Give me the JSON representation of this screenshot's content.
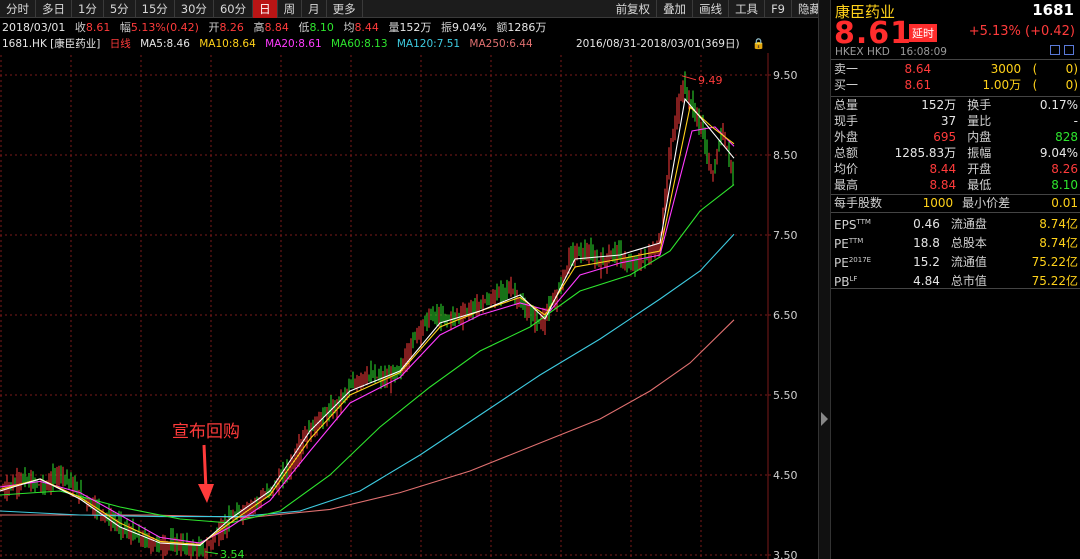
{
  "toolbar": {
    "left_tabs": [
      "分时",
      "多日",
      "1分",
      "5分",
      "15分",
      "30分",
      "60分",
      "日",
      "周",
      "月",
      "更多"
    ],
    "active": "日",
    "right_tabs": [
      "前复权",
      "叠加",
      "画线",
      "工具",
      "F9",
      "隐藏"
    ]
  },
  "info": {
    "date": "2018/03/01",
    "close_label": "收",
    "close": "8.61",
    "change_label": "幅",
    "change": "5.13%(0.42)",
    "open_label": "开",
    "open": "8.26",
    "high_label": "高",
    "high": "8.84",
    "low_label": "低",
    "low": "8.10",
    "avg_label": "均",
    "avg": "8.44",
    "vol_label": "量",
    "vol": "152万",
    "amp_label": "振",
    "amp": "9.04%",
    "amt_label": "额",
    "amt": "1286万"
  },
  "ma_bar": {
    "code": "1681.HK [康臣药业]",
    "period": "日线",
    "ma5": "MA5:8.46",
    "ma10": "MA10:8.64",
    "ma20": "MA20:8.61",
    "ma60": "MA60:8.13",
    "ma120": "MA120:7.51",
    "ma250": "MA250:6.44",
    "range": "2016/08/31-2018/03/01(369日)"
  },
  "chart_data": {
    "type": "line",
    "y_ticks": [
      "9.50",
      "8.50",
      "7.50",
      "6.50",
      "5.50",
      "4.50",
      "3.50"
    ],
    "ylim": [
      3.45,
      9.75
    ],
    "x_days": 369,
    "annotations": {
      "high": "9.49",
      "low": "3.54",
      "event": "宣布回购"
    },
    "colors": {
      "price_up": "#ff3b3b",
      "price_down": "#2ee52e",
      "ma5": "#ffffff",
      "ma10": "#ffd21a",
      "ma20": "#ff3bff",
      "ma60": "#2ee52e",
      "ma120": "#3ecbe0",
      "ma250": "#e07070",
      "grid": "#7a1a1a",
      "axis_text": "#cfcfcf",
      "annotation": "#ff3b3b"
    },
    "price_path": [
      [
        0,
        4.3
      ],
      [
        20,
        4.45
      ],
      [
        45,
        4.35
      ],
      [
        60,
        4.55
      ],
      [
        80,
        4.25
      ],
      [
        100,
        4.05
      ],
      [
        120,
        3.85
      ],
      [
        140,
        3.7
      ],
      [
        160,
        3.62
      ],
      [
        175,
        3.65
      ],
      [
        190,
        3.58
      ],
      [
        205,
        3.55
      ],
      [
        215,
        3.75
      ],
      [
        230,
        3.95
      ],
      [
        250,
        4.1
      ],
      [
        270,
        4.3
      ],
      [
        290,
        4.6
      ],
      [
        305,
        5.0
      ],
      [
        320,
        5.2
      ],
      [
        335,
        5.35
      ],
      [
        350,
        5.6
      ],
      [
        365,
        5.75
      ],
      [
        385,
        5.7
      ],
      [
        400,
        5.8
      ],
      [
        415,
        6.25
      ],
      [
        430,
        6.5
      ],
      [
        445,
        6.45
      ],
      [
        460,
        6.5
      ],
      [
        475,
        6.6
      ],
      [
        490,
        6.7
      ],
      [
        510,
        6.85
      ],
      [
        525,
        6.55
      ],
      [
        540,
        6.4
      ],
      [
        555,
        6.7
      ],
      [
        570,
        7.25
      ],
      [
        585,
        7.3
      ],
      [
        600,
        7.15
      ],
      [
        615,
        7.3
      ],
      [
        630,
        7.1
      ],
      [
        645,
        7.2
      ],
      [
        660,
        7.4
      ],
      [
        670,
        8.6
      ],
      [
        682,
        9.4
      ],
      [
        692,
        9.1
      ],
      [
        702,
        8.8
      ],
      [
        712,
        8.2
      ],
      [
        722,
        8.85
      ],
      [
        734,
        8.1
      ]
    ],
    "ma5": [
      [
        0,
        4.3
      ],
      [
        40,
        4.45
      ],
      [
        80,
        4.2
      ],
      [
        120,
        3.85
      ],
      [
        160,
        3.65
      ],
      [
        200,
        3.62
      ],
      [
        230,
        3.95
      ],
      [
        270,
        4.3
      ],
      [
        310,
        5.05
      ],
      [
        350,
        5.55
      ],
      [
        400,
        5.8
      ],
      [
        440,
        6.4
      ],
      [
        480,
        6.55
      ],
      [
        520,
        6.75
      ],
      [
        545,
        6.45
      ],
      [
        575,
        7.2
      ],
      [
        620,
        7.25
      ],
      [
        660,
        7.4
      ],
      [
        685,
        9.2
      ],
      [
        705,
        8.9
      ],
      [
        734,
        8.46
      ]
    ],
    "ma10": [
      [
        0,
        4.32
      ],
      [
        40,
        4.45
      ],
      [
        80,
        4.22
      ],
      [
        120,
        3.9
      ],
      [
        160,
        3.67
      ],
      [
        200,
        3.63
      ],
      [
        230,
        3.9
      ],
      [
        270,
        4.25
      ],
      [
        310,
        4.95
      ],
      [
        350,
        5.5
      ],
      [
        400,
        5.78
      ],
      [
        440,
        6.35
      ],
      [
        480,
        6.55
      ],
      [
        520,
        6.72
      ],
      [
        545,
        6.5
      ],
      [
        575,
        7.1
      ],
      [
        620,
        7.2
      ],
      [
        660,
        7.3
      ],
      [
        690,
        9.1
      ],
      [
        712,
        8.85
      ],
      [
        734,
        8.64
      ]
    ],
    "ma20": [
      [
        0,
        4.35
      ],
      [
        40,
        4.42
      ],
      [
        80,
        4.28
      ],
      [
        120,
        4.0
      ],
      [
        160,
        3.72
      ],
      [
        200,
        3.65
      ],
      [
        230,
        3.85
      ],
      [
        270,
        4.18
      ],
      [
        310,
        4.8
      ],
      [
        350,
        5.4
      ],
      [
        400,
        5.72
      ],
      [
        440,
        6.25
      ],
      [
        480,
        6.5
      ],
      [
        520,
        6.65
      ],
      [
        550,
        6.55
      ],
      [
        580,
        7.0
      ],
      [
        620,
        7.15
      ],
      [
        660,
        7.25
      ],
      [
        692,
        8.8
      ],
      [
        715,
        8.85
      ],
      [
        734,
        8.61
      ]
    ],
    "ma60": [
      [
        0,
        4.25
      ],
      [
        60,
        4.3
      ],
      [
        120,
        4.1
      ],
      [
        180,
        3.95
      ],
      [
        230,
        3.9
      ],
      [
        280,
        4.05
      ],
      [
        330,
        4.5
      ],
      [
        380,
        5.1
      ],
      [
        430,
        5.6
      ],
      [
        480,
        6.05
      ],
      [
        530,
        6.35
      ],
      [
        580,
        6.8
      ],
      [
        630,
        7.0
      ],
      [
        670,
        7.3
      ],
      [
        700,
        7.8
      ],
      [
        734,
        8.13
      ]
    ],
    "ma120": [
      [
        0,
        4.05
      ],
      [
        80,
        4.0
      ],
      [
        160,
        3.98
      ],
      [
        240,
        3.98
      ],
      [
        300,
        4.05
      ],
      [
        360,
        4.3
      ],
      [
        420,
        4.75
      ],
      [
        480,
        5.25
      ],
      [
        540,
        5.75
      ],
      [
        600,
        6.2
      ],
      [
        660,
        6.7
      ],
      [
        700,
        7.05
      ],
      [
        734,
        7.51
      ]
    ],
    "ma250": [
      [
        0,
        4.0
      ],
      [
        150,
        4.0
      ],
      [
        250,
        3.97
      ],
      [
        330,
        4.07
      ],
      [
        400,
        4.28
      ],
      [
        470,
        4.55
      ],
      [
        540,
        4.9
      ],
      [
        600,
        5.2
      ],
      [
        650,
        5.55
      ],
      [
        690,
        5.9
      ],
      [
        734,
        6.44
      ]
    ]
  },
  "panel": {
    "name": "康臣药业",
    "code": "1681",
    "price": "8.61",
    "delay": "延时",
    "change": "+5.13% (+0.42)",
    "exchange": "HKEX HKD",
    "time": "16:08:09",
    "icons": [
      "lock-icon",
      "layout-icon"
    ],
    "orderbook": [
      {
        "label": "卖一",
        "price": "8.64",
        "qty": "3000",
        "count": "(",
        "num": "0",
        "close": ")"
      },
      {
        "label": "买一",
        "price": "8.61",
        "qty": "1.00万",
        "count": "(",
        "num": "0",
        "close": ")"
      }
    ],
    "stats": [
      [
        "总量",
        "152万",
        "换手",
        "0.17%"
      ],
      [
        "现手",
        "37",
        "量比",
        "-"
      ],
      [
        "外盘",
        "695",
        "内盘",
        "828"
      ],
      [
        "总额",
        "1285.83万",
        "振幅",
        "9.04%"
      ],
      [
        "均价",
        "8.44",
        "开盘",
        "8.26"
      ],
      [
        "最高",
        "8.84",
        "最低",
        "8.10"
      ]
    ],
    "lots": [
      [
        "每手股数",
        "1000",
        "最小价差",
        "0.01"
      ]
    ],
    "valuation": [
      [
        "EPS",
        "TTM",
        "0.46",
        "流通盘",
        "8.74亿"
      ],
      [
        "PE",
        "TTM",
        "18.8",
        "总股本",
        "8.74亿"
      ],
      [
        "PE",
        "2017E",
        "15.2",
        "流通值",
        "75.22亿"
      ],
      [
        "PB",
        "LF",
        "4.84",
        "总市值",
        "75.22亿"
      ]
    ]
  }
}
